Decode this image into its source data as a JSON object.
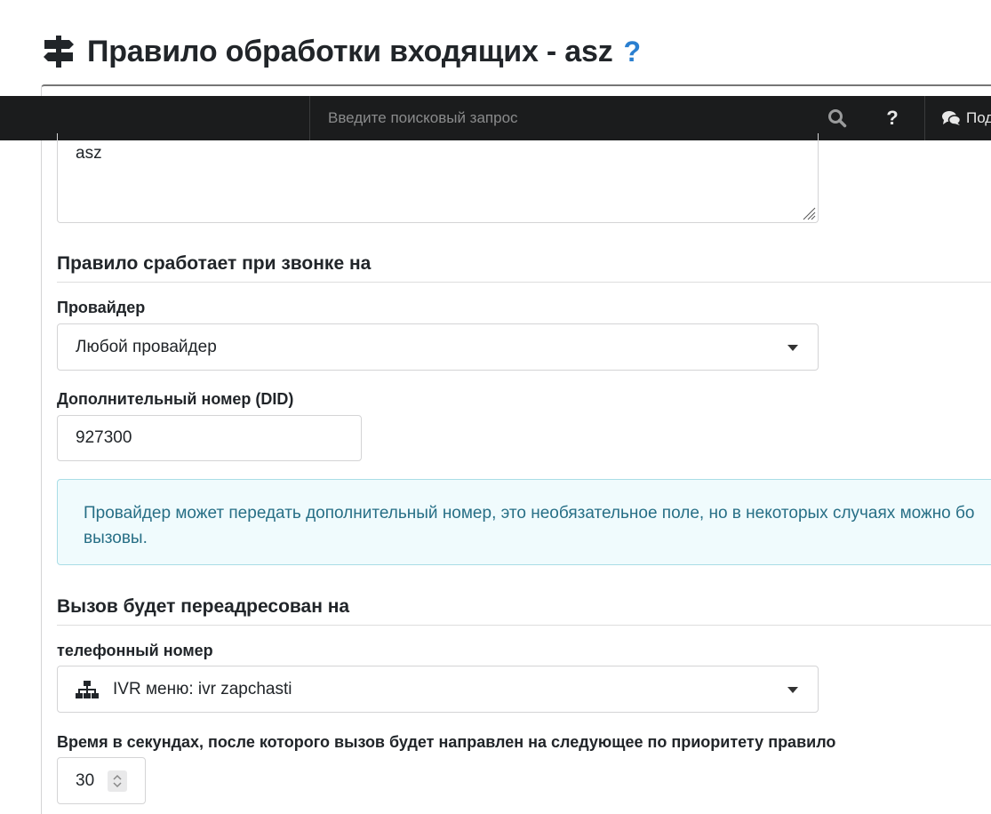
{
  "header": {
    "title": "Правило обработки входящих - asz",
    "help_symbol": "?",
    "icon": "signpost-icon"
  },
  "topbar": {
    "search_placeholder": "Введите поисковый запрос",
    "search_icon": "search-icon",
    "help_symbol": "?",
    "support_label": "Под",
    "support_icon": "comments-icon"
  },
  "form": {
    "description_value": "asz",
    "section_trigger": "Правило сработает при звонке на",
    "provider_label": "Провайдер",
    "provider_value": "Любой провайдер",
    "did_label": "Дополнительный номер (DID)",
    "did_value": "927300",
    "info_line1": "Провайдер может передать дополнительный номер, это необязательное поле, но в некоторых случаях можно бо",
    "info_line2": "вызовы.",
    "section_redirect": "Вызов будет переадресован на",
    "phone_label": "телефонный номер",
    "phone_value": "IVR меню: ivr zapchasti",
    "phone_icon": "sitemap-icon",
    "timeout_label": "Время в секундах, после которого вызов будет направлен на следующее по приоритету правило",
    "timeout_value": "30"
  },
  "colors": {
    "topbar_bg": "#1b1c1d",
    "help_accent": "#2a7fd0",
    "info_bg": "#f0fbfd",
    "info_text": "#276f86"
  }
}
